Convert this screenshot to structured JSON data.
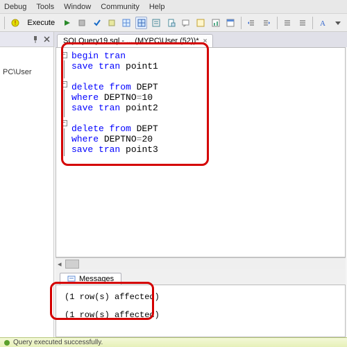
{
  "menu": {
    "debug": "Debug",
    "tools": "Tools",
    "window": "Window",
    "community": "Community",
    "help": "Help"
  },
  "toolbar": {
    "execute": "Execute"
  },
  "sidebar": {
    "path": "PC\\User"
  },
  "tab": {
    "title": "SQLQuery19.sql - ... (MYPC\\User (52))*"
  },
  "code": {
    "l1a": "begin",
    "l1b": " tran",
    "l2a": "save",
    "l2b": " tran",
    "l2c": " point1",
    "l3a": "delete",
    "l3b": " from",
    "l3c": " DEPT",
    "l4a": "where",
    "l4b": " DEPTNO",
    "l4c": "=",
    "l4d": "10",
    "l5a": "save",
    "l5b": " tran",
    "l5c": " point2",
    "l6a": "delete",
    "l6b": " from",
    "l6c": " DEPT",
    "l7a": "where",
    "l7b": " DEPTNO",
    "l7c": "=",
    "l7d": "20",
    "l8a": "save",
    "l8b": " tran",
    "l8c": " point3"
  },
  "messages": {
    "tab": "Messages",
    "row1": "(1 row(s) affected)",
    "row2": "(1 row(s) affected)"
  },
  "status": {
    "text": "Query executed successfully."
  }
}
